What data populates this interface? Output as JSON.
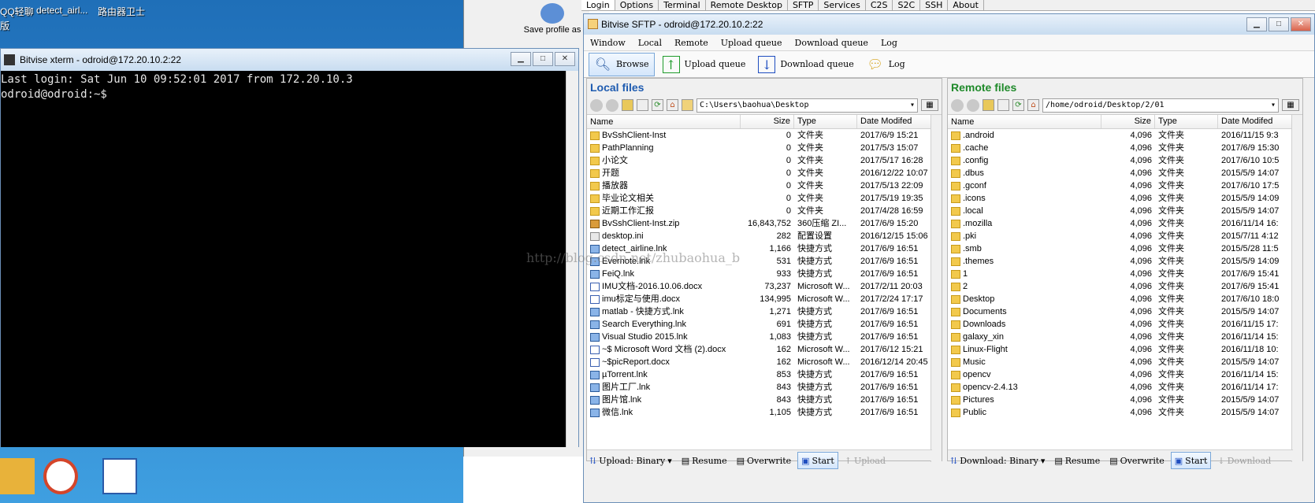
{
  "desktop": {
    "top_labels": [
      "QQ轻聊",
      "detect_airl...",
      "路由器卫士"
    ],
    "side_char": "版"
  },
  "bg_window": {
    "tabs": [
      "Login",
      "Options",
      "Terminal",
      "Remote Desktop",
      "SFTP",
      "Services",
      "C2S",
      "S2C",
      "SSH",
      "About"
    ],
    "save_profile": "Save profile as"
  },
  "xterm": {
    "title": "Bitvise xterm - odroid@172.20.10.2:22",
    "lines": [
      "Last login: Sat Jun 10 09:52:01 2017 from 172.20.10.3",
      "odroid@odroid:~$"
    ]
  },
  "sftp": {
    "title": "Bitvise SFTP - odroid@172.20.10.2:22",
    "menu": [
      "Window",
      "Local",
      "Remote",
      "Upload queue",
      "Download queue",
      "Log"
    ],
    "toolbar": {
      "browse": "Browse",
      "upload_queue": "Upload queue",
      "download_queue": "Download queue",
      "log": "Log"
    },
    "local": {
      "title": "Local files",
      "path": "C:\\Users\\baohua\\Desktop",
      "columns": [
        "Name",
        "Size",
        "Type",
        "Date Modifed"
      ],
      "rows": [
        [
          "BvSshClient-Inst",
          "0",
          "文件夹",
          "2017/6/9 15:21",
          "folder"
        ],
        [
          "PathPlanning",
          "0",
          "文件夹",
          "2017/5/3 15:07",
          "folder"
        ],
        [
          "小论文",
          "0",
          "文件夹",
          "2017/5/17 16:28",
          "folder"
        ],
        [
          "开题",
          "0",
          "文件夹",
          "2016/12/22 10:07",
          "folder"
        ],
        [
          "播放器",
          "0",
          "文件夹",
          "2017/5/13 22:09",
          "folder"
        ],
        [
          "毕业论文相关",
          "0",
          "文件夹",
          "2017/5/19 19:35",
          "folder"
        ],
        [
          "近期工作汇报",
          "0",
          "文件夹",
          "2017/4/28 16:59",
          "folder"
        ],
        [
          "BvSshClient-Inst.zip",
          "16,843,752",
          "360压缩 ZI...",
          "2017/6/9 15:20",
          "zip"
        ],
        [
          "desktop.ini",
          "282",
          "配置设置",
          "2016/12/15 15:06",
          "ini"
        ],
        [
          "detect_airline.lnk",
          "1,166",
          "快捷方式",
          "2017/6/9 16:51",
          "lnk"
        ],
        [
          "Evernote.lnk",
          "531",
          "快捷方式",
          "2017/6/9 16:51",
          "lnk"
        ],
        [
          "FeiQ.lnk",
          "933",
          "快捷方式",
          "2017/6/9 16:51",
          "lnk"
        ],
        [
          "IMU文档-2016.10.06.docx",
          "73,237",
          "Microsoft W...",
          "2017/2/11 20:03",
          "doc"
        ],
        [
          "imu标定与使用.docx",
          "134,995",
          "Microsoft W...",
          "2017/2/24 17:17",
          "doc"
        ],
        [
          "matlab - 快捷方式.lnk",
          "1,271",
          "快捷方式",
          "2017/6/9 16:51",
          "lnk"
        ],
        [
          "Search Everything.lnk",
          "691",
          "快捷方式",
          "2017/6/9 16:51",
          "lnk"
        ],
        [
          "Visual Studio 2015.lnk",
          "1,083",
          "快捷方式",
          "2017/6/9 16:51",
          "lnk"
        ],
        [
          "~$ Microsoft Word 文档 (2).docx",
          "162",
          "Microsoft W...",
          "2017/6/12 15:21",
          "doc"
        ],
        [
          "~$picReport.docx",
          "162",
          "Microsoft W...",
          "2016/12/14 20:45",
          "doc"
        ],
        [
          "µTorrent.lnk",
          "853",
          "快捷方式",
          "2017/6/9 16:51",
          "lnk"
        ],
        [
          "图片工厂.lnk",
          "843",
          "快捷方式",
          "2017/6/9 16:51",
          "lnk"
        ],
        [
          "图片馆.lnk",
          "843",
          "快捷方式",
          "2017/6/9 16:51",
          "lnk"
        ],
        [
          "微信.lnk",
          "1,105",
          "快捷方式",
          "2017/6/9 16:51",
          "lnk"
        ]
      ]
    },
    "remote": {
      "title": "Remote files",
      "path": "/home/odroid/Desktop/2/01",
      "columns": [
        "Name",
        "Size",
        "Type",
        "Date Modifed"
      ],
      "rows": [
        [
          ".android",
          "4,096",
          "文件夹",
          "2016/11/15 9:3",
          "folder"
        ],
        [
          ".cache",
          "4,096",
          "文件夹",
          "2017/6/9 15:30",
          "folder"
        ],
        [
          ".config",
          "4,096",
          "文件夹",
          "2017/6/10 10:5",
          "folder"
        ],
        [
          ".dbus",
          "4,096",
          "文件夹",
          "2015/5/9 14:07",
          "folder"
        ],
        [
          ".gconf",
          "4,096",
          "文件夹",
          "2017/6/10 17:5",
          "folder"
        ],
        [
          ".icons",
          "4,096",
          "文件夹",
          "2015/5/9 14:09",
          "folder"
        ],
        [
          ".local",
          "4,096",
          "文件夹",
          "2015/5/9 14:07",
          "folder"
        ],
        [
          ".mozilla",
          "4,096",
          "文件夹",
          "2016/11/14 16:",
          "folder"
        ],
        [
          ".pki",
          "4,096",
          "文件夹",
          "2015/7/11 4:12",
          "folder"
        ],
        [
          ".smb",
          "4,096",
          "文件夹",
          "2015/5/28 11:5",
          "folder"
        ],
        [
          ".themes",
          "4,096",
          "文件夹",
          "2015/5/9 14:09",
          "folder"
        ],
        [
          "1",
          "4,096",
          "文件夹",
          "2017/6/9 15:41",
          "folder"
        ],
        [
          "2",
          "4,096",
          "文件夹",
          "2017/6/9 15:41",
          "folder"
        ],
        [
          "Desktop",
          "4,096",
          "文件夹",
          "2017/6/10 18:0",
          "folder"
        ],
        [
          "Documents",
          "4,096",
          "文件夹",
          "2015/5/9 14:07",
          "folder"
        ],
        [
          "Downloads",
          "4,096",
          "文件夹",
          "2016/11/15 17:",
          "folder"
        ],
        [
          "galaxy_xin",
          "4,096",
          "文件夹",
          "2016/11/14 15:",
          "folder"
        ],
        [
          "Linux-Flight",
          "4,096",
          "文件夹",
          "2016/11/18 10:",
          "folder"
        ],
        [
          "Music",
          "4,096",
          "文件夹",
          "2015/5/9 14:07",
          "folder"
        ],
        [
          "opencv",
          "4,096",
          "文件夹",
          "2016/11/14 15:",
          "folder"
        ],
        [
          "opencv-2.4.13",
          "4,096",
          "文件夹",
          "2016/11/14 17:",
          "folder"
        ],
        [
          "Pictures",
          "4,096",
          "文件夹",
          "2015/5/9 14:07",
          "folder"
        ],
        [
          "Public",
          "4,096",
          "文件夹",
          "2015/5/9 14:07",
          "folder"
        ]
      ]
    },
    "upload_bar": {
      "mode": "Upload: Binary",
      "resume": "Resume",
      "overwrite": "Overwrite",
      "start": "Start",
      "action": "Upload"
    },
    "download_bar": {
      "mode": "Download: Binary",
      "resume": "Resume",
      "overwrite": "Overwrite",
      "start": "Start",
      "action": "Download"
    }
  },
  "watermark": "http://blog.csdn.net/zhubaohua_b"
}
